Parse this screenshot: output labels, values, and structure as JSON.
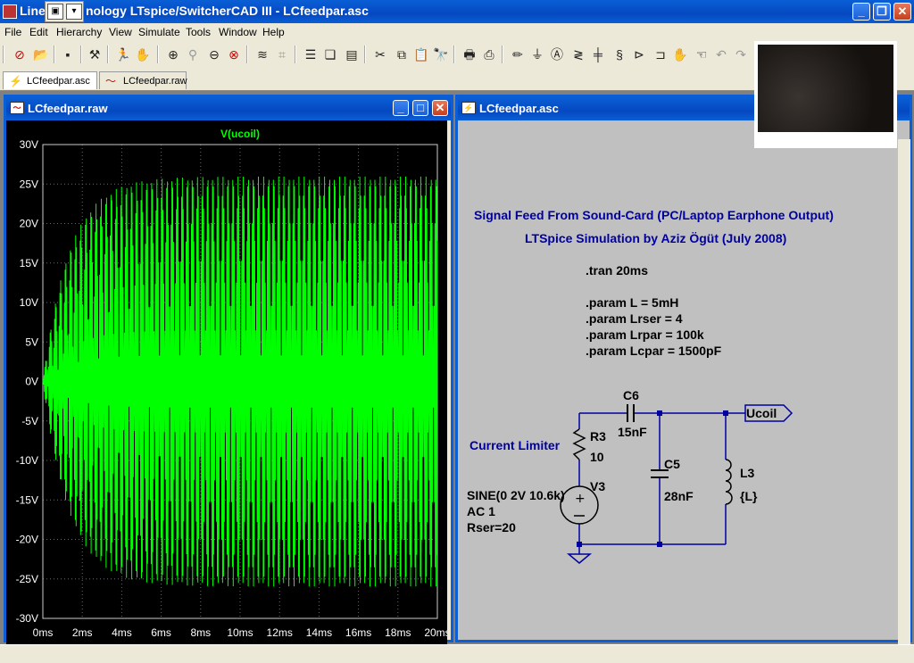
{
  "app": {
    "title": "Linear Technology LTspice/SwitcherCAD III - LCfeedpar.asc",
    "title_visible": "nology LTspice/SwitcherCAD III - LCfeedpar.asc",
    "title_prefix": "Line"
  },
  "menu": [
    "File",
    "Edit",
    "Hierarchy",
    "View",
    "Simulate",
    "Tools",
    "Window",
    "Help"
  ],
  "tabs": [
    {
      "label": "LCfeedpar.asc",
      "icon": "schematic-icon",
      "active": true
    },
    {
      "label": "LCfeedpar.raw",
      "icon": "waveform-icon",
      "active": false
    }
  ],
  "plot_window": {
    "title": "LCfeedpar.raw"
  },
  "schematic_window": {
    "title": "LCfeedpar.asc"
  },
  "schematic": {
    "heading1": "Signal Feed From Sound-Card (PC/Laptop Earphone Output)",
    "heading2": "LTSpice Simulation by Aziz Ögüt (July 2008)",
    "directives": [
      ".tran 20ms",
      ".param L = 5mH",
      ".param Lrser = 4",
      ".param Lrpar = 100k",
      ".param Lcpar = 1500pF"
    ],
    "current_limiter": "Current Limiter",
    "R3_name": "R3",
    "R3_value": "10",
    "C6_name": "C6",
    "C6_value": "15nF",
    "C5_name": "C5",
    "C5_value": "28nF",
    "L3_name": "L3",
    "L3_value": "{L}",
    "V3_name": "V3",
    "V3_spec": [
      "SINE(0 2V 10.6k)",
      "AC 1",
      "Rser=20"
    ],
    "net_label": "Ucoil"
  },
  "chart_data": {
    "type": "line",
    "title": "V(ucoil)",
    "series": [
      {
        "name": "V(ucoil)",
        "color": "#00ff00",
        "frequency_hz": 10600,
        "steady_amplitude_v": 26,
        "rise_time_ms": 6
      }
    ],
    "x": {
      "label": "",
      "ticks": [
        "0ms",
        "2ms",
        "4ms",
        "6ms",
        "8ms",
        "10ms",
        "12ms",
        "14ms",
        "16ms",
        "18ms",
        "20ms"
      ],
      "range_ms": [
        0,
        20
      ]
    },
    "y": {
      "label": "",
      "ticks": [
        "30V",
        "25V",
        "20V",
        "15V",
        "10V",
        "5V",
        "0V",
        "-5V",
        "-10V",
        "-15V",
        "-20V",
        "-25V",
        "-30V"
      ],
      "range_v": [
        -30,
        30
      ]
    },
    "grid": true
  },
  "colors": {
    "titlebar": "#0a5fd6",
    "trace": "#00ff00",
    "schematic_bg": "#c0c0c0",
    "wire": "#0000a0"
  }
}
